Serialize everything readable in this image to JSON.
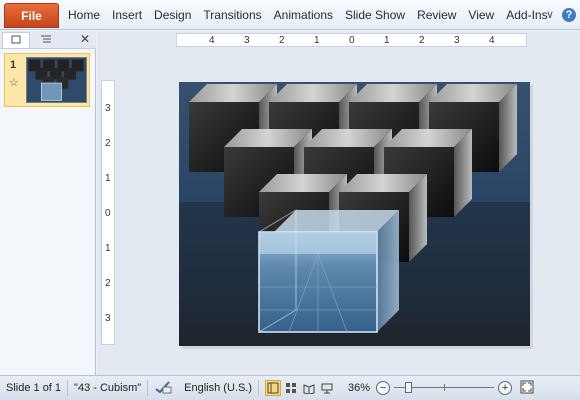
{
  "ribbon": {
    "file_label": "File",
    "tabs": [
      "Home",
      "Insert",
      "Design",
      "Transitions",
      "Animations",
      "Slide Show",
      "Review",
      "View",
      "Add-Ins"
    ],
    "minimize_glyph": "∨",
    "help_glyph": "?"
  },
  "left_pane": {
    "slides_tab_icon": "slides-tab-icon",
    "outline_tab_icon": "outline-tab-icon",
    "close_glyph": "✕",
    "thumb_number": "1",
    "thumb_star": "☆"
  },
  "rulers": {
    "horizontal": [
      "4",
      "3",
      "2",
      "1",
      "0",
      "1",
      "2",
      "3",
      "4"
    ],
    "vertical": [
      "3",
      "2",
      "1",
      "0",
      "1",
      "2",
      "3"
    ]
  },
  "status": {
    "slide_info": "Slide 1 of 1",
    "theme": "\"43 - Cubism\"",
    "language": "English (U.S.)",
    "zoom": "36%",
    "zoom_fraction": 0.36,
    "zoom_out": "−",
    "zoom_in": "+"
  },
  "colors": {
    "file_tab": "#d2552a",
    "selected_thumb": "#fbe7a7",
    "slide_bg": "#2f4a6a"
  }
}
